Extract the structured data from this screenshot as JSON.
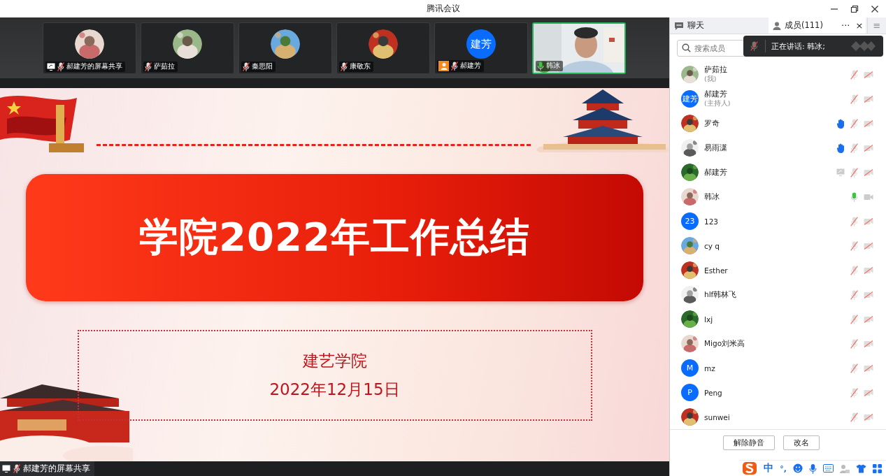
{
  "window": {
    "title": "腾讯会议"
  },
  "tiles": [
    {
      "name": "郝建芳的屏幕共享",
      "sharing": true,
      "host": false,
      "mic_on": false,
      "selected": false
    },
    {
      "name": "萨茹拉",
      "sharing": false,
      "host": false,
      "mic_on": false,
      "selected": false
    },
    {
      "name": "秦思阳",
      "sharing": false,
      "host": false,
      "mic_on": false,
      "selected": false
    },
    {
      "name": "康敬东",
      "sharing": false,
      "host": false,
      "mic_on": false,
      "selected": false
    },
    {
      "name": "郝建芳",
      "avatar": {
        "kind": "initial",
        "text": "建芳"
      },
      "sharing": false,
      "host": true,
      "mic_on": false,
      "selected": false
    },
    {
      "name": "韩冰",
      "avatar": {
        "kind": "video"
      },
      "sharing": false,
      "host": false,
      "mic_on": true,
      "selected": true
    }
  ],
  "slide": {
    "title": "学院2022年工作总结",
    "org": "建艺学院",
    "date": "2022年12月15日"
  },
  "share_label": {
    "text": "郝建芳的屏幕共享",
    "mic_on": false
  },
  "panel": {
    "tabs": [
      {
        "label": "聊天",
        "selected": false
      },
      {
        "label": "成员(111)",
        "selected": true
      }
    ],
    "more": "···",
    "close": "×",
    "menu": "≡",
    "search": {
      "placeholder": "搜索成员"
    },
    "speaking_toast": {
      "text": "正在讲话: 韩冰;"
    },
    "members": [
      {
        "name": "萨茹拉",
        "role": "(我)",
        "hand_raised": false,
        "sharing": false,
        "mic_on": false,
        "camera_on": false
      },
      {
        "name": "郝建芳",
        "role": "(主持人)",
        "avatar": {
          "kind": "initial",
          "text": "建芳"
        },
        "hand_raised": false,
        "sharing": false,
        "mic_on": false,
        "camera_on": false
      },
      {
        "name": "罗奇",
        "hand_raised": true,
        "sharing": false,
        "mic_on": false,
        "camera_on": false
      },
      {
        "name": "易雨潇",
        "hand_raised": true,
        "sharing": false,
        "mic_on": false,
        "camera_on": false
      },
      {
        "name": "郝建芳",
        "hand_raised": false,
        "sharing": true,
        "mic_on": false,
        "camera_on": false
      },
      {
        "name": "韩冰",
        "hand_raised": false,
        "sharing": false,
        "mic_on": true,
        "camera_on": true
      },
      {
        "name": "123",
        "avatar": {
          "kind": "initial",
          "text": "23"
        },
        "hand_raised": false,
        "sharing": false,
        "mic_on": false,
        "camera_on": false
      },
      {
        "name": "cy q",
        "hand_raised": false,
        "sharing": false,
        "mic_on": false,
        "camera_on": false
      },
      {
        "name": "Esther",
        "hand_raised": false,
        "sharing": false,
        "mic_on": false,
        "camera_on": false
      },
      {
        "name": "hlf韩林飞",
        "hand_raised": false,
        "sharing": false,
        "mic_on": false,
        "camera_on": false
      },
      {
        "name": "lxj",
        "hand_raised": false,
        "sharing": false,
        "mic_on": false,
        "camera_on": false
      },
      {
        "name": "Migo刘米高",
        "hand_raised": false,
        "sharing": false,
        "mic_on": false,
        "camera_on": false
      },
      {
        "name": "mz",
        "avatar": {
          "kind": "initial",
          "text": "M"
        },
        "hand_raised": false,
        "sharing": false,
        "mic_on": false,
        "camera_on": false
      },
      {
        "name": "Peng",
        "avatar": {
          "kind": "initial",
          "text": "P"
        },
        "hand_raised": false,
        "sharing": false,
        "mic_on": false,
        "camera_on": false
      },
      {
        "name": "sunwei",
        "hand_raised": false,
        "sharing": false,
        "mic_on": false,
        "camera_on": false
      }
    ],
    "buttons": [
      "解除静音",
      "改名"
    ]
  },
  "ime": {
    "mode": "中",
    "punct": "°,"
  }
}
